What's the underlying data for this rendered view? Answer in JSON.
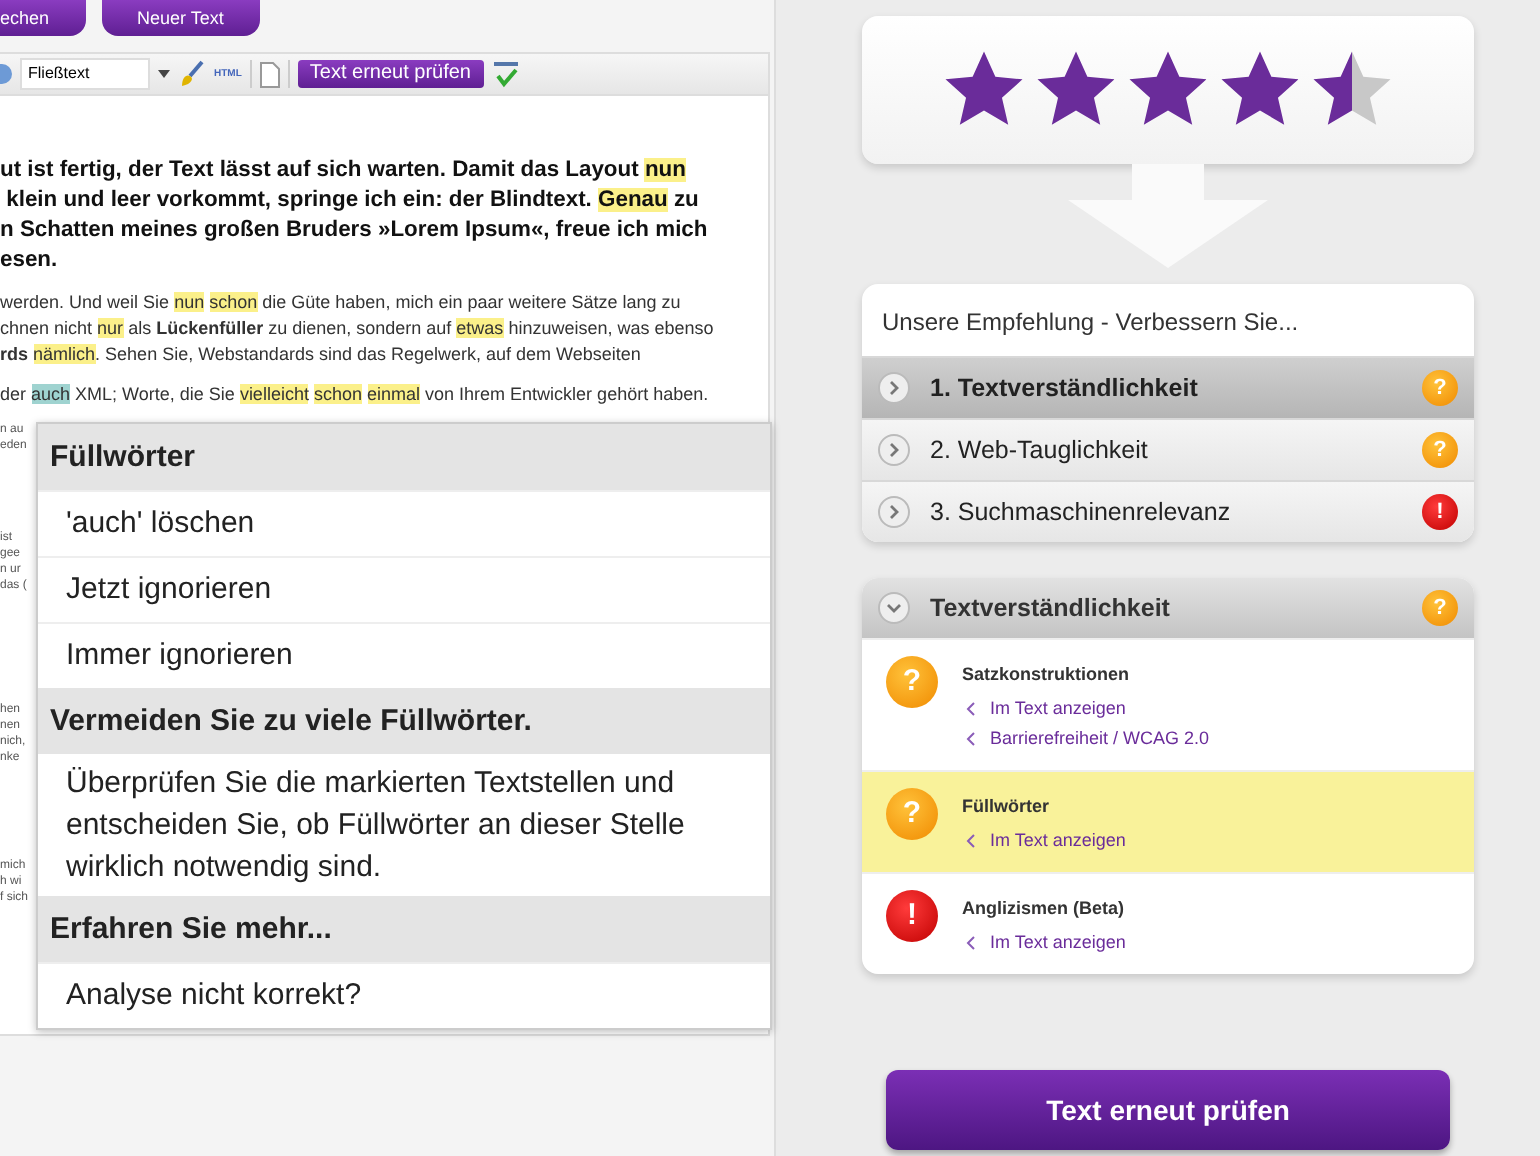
{
  "top_buttons": [
    "echen",
    "Neuer Text"
  ],
  "toolbar": {
    "style_select": "Fließtext",
    "html_label": "HTML",
    "check_button": "Text erneut prüfen"
  },
  "editor": {
    "paragraphs": [
      {
        "kind": "lead",
        "lines": [
          [
            {
              "kind": "text",
              "text": "ut ist fertig, der Text lässt auf sich warten. Damit das Layout"
            },
            {
              "kind": "filler",
              "text": "nun",
              "space_before": true
            }
          ],
          [
            {
              "kind": "text",
              "text": " klein und leer vorkommt, springe ich ein: der Blindtext."
            },
            {
              "kind": "filler",
              "text": "Genau",
              "space_before": true
            },
            {
              "kind": "text",
              "text": " zu"
            }
          ],
          [
            {
              "kind": "text",
              "text": "n Schatten meines großen Bruders »Lorem Ipsum«, freue ich mich"
            }
          ],
          [
            {
              "kind": "text",
              "text": "esen."
            }
          ]
        ]
      },
      {
        "kind": "small",
        "lines": [
          [
            {
              "kind": "text",
              "text": "werden. Und weil Sie"
            },
            {
              "kind": "filler",
              "text": "nun",
              "space_before": true
            },
            {
              "kind": "filler",
              "text": "schon",
              "space_before": true
            },
            {
              "kind": "text",
              "text": " die Güte haben, mich ein paar weitere Sätze lang zu"
            }
          ],
          [
            {
              "kind": "text",
              "text": "chnen nicht "
            },
            {
              "kind": "filler",
              "text": "nur"
            },
            {
              "kind": "text",
              "text": " als "
            },
            {
              "kind": "bold",
              "text": "Lückenfüller"
            },
            {
              "kind": "text",
              "text": " zu dienen, sondern auf "
            },
            {
              "kind": "filler",
              "text": "etwas"
            },
            {
              "kind": "text",
              "text": " hinzuweisen, was ebenso"
            }
          ],
          [
            {
              "kind": "bold",
              "text": "rds"
            },
            {
              "kind": "filler",
              "text": "nämlich",
              "space_before": true
            },
            {
              "kind": "text",
              "text": ". Sehen Sie, Webstandards sind das Regelwerk, auf dem Webseiten"
            }
          ]
        ]
      },
      {
        "kind": "small",
        "lines": [
          [
            {
              "kind": "text",
              "text": "der "
            },
            {
              "kind": "current",
              "text": "auch"
            },
            {
              "kind": "text",
              "text": " XML; Worte, die Sie"
            },
            {
              "kind": "filler",
              "text": "vielleicht",
              "space_before": true
            },
            {
              "kind": "filler",
              "text": "schon",
              "space_before": true
            },
            {
              "kind": "filler",
              "text": "einmal",
              "space_before": true
            },
            {
              "kind": "text",
              "text": " von Ihrem Entwickler gehört haben."
            }
          ]
        ]
      }
    ],
    "margin_fragments": [
      [
        "n au",
        "eden"
      ],
      [
        "ist",
        "gee",
        "n ur",
        "das ("
      ],
      [
        "hen",
        "nen",
        "nich,",
        "nke"
      ],
      [
        "mich",
        "h wi",
        "f sich"
      ]
    ]
  },
  "popup": [
    {
      "kind": "header",
      "text": "Füllwörter"
    },
    {
      "kind": "action",
      "text": "'auch' löschen"
    },
    {
      "kind": "action",
      "text": "Jetzt ignorieren"
    },
    {
      "kind": "action",
      "text": "Immer ignorieren"
    },
    {
      "kind": "header",
      "text": "Vermeiden Sie zu viele Füllwörter."
    },
    {
      "kind": "note",
      "text": "Überprüfen Sie die markierten Textstellen und entscheiden Sie, ob Füllwörter an dieser Stelle wirklich notwendig sind."
    },
    {
      "kind": "header",
      "text": "Erfahren Sie mehr..."
    },
    {
      "kind": "action",
      "text": "Analyse nicht korrekt?"
    }
  ],
  "rating": {
    "stars": 4.5
  },
  "recommendation": {
    "title": "Unsere Empfehlung - Verbessern Sie...",
    "items": [
      {
        "label": "1. Textverständlichkeit",
        "selected": true,
        "kind": "warning",
        "icon": "?"
      },
      {
        "label": "2. Web-Tauglichkeit",
        "selected": false,
        "kind": "warning",
        "icon": "?"
      },
      {
        "label": "3. Suchmaschinenrelevanz",
        "selected": false,
        "kind": "error",
        "icon": "!"
      }
    ]
  },
  "details": {
    "title": "Textverständlichkeit",
    "kind": "warning",
    "icon": "?",
    "entries": [
      {
        "title": "Satzkonstruktionen",
        "kind": "warning",
        "icon": "?",
        "highlighted": false,
        "links": [
          "Im Text anzeigen",
          "Barrierefreiheit / WCAG 2.0"
        ]
      },
      {
        "title": "Füllwörter",
        "kind": "warning",
        "icon": "?",
        "highlighted": true,
        "links": [
          "Im Text anzeigen"
        ]
      },
      {
        "title": "Anglizismen (Beta)",
        "kind": "error",
        "icon": "!",
        "highlighted": false,
        "links": [
          "Im Text anzeigen"
        ]
      }
    ]
  },
  "recheck_button": "Text erneut prüfen"
}
